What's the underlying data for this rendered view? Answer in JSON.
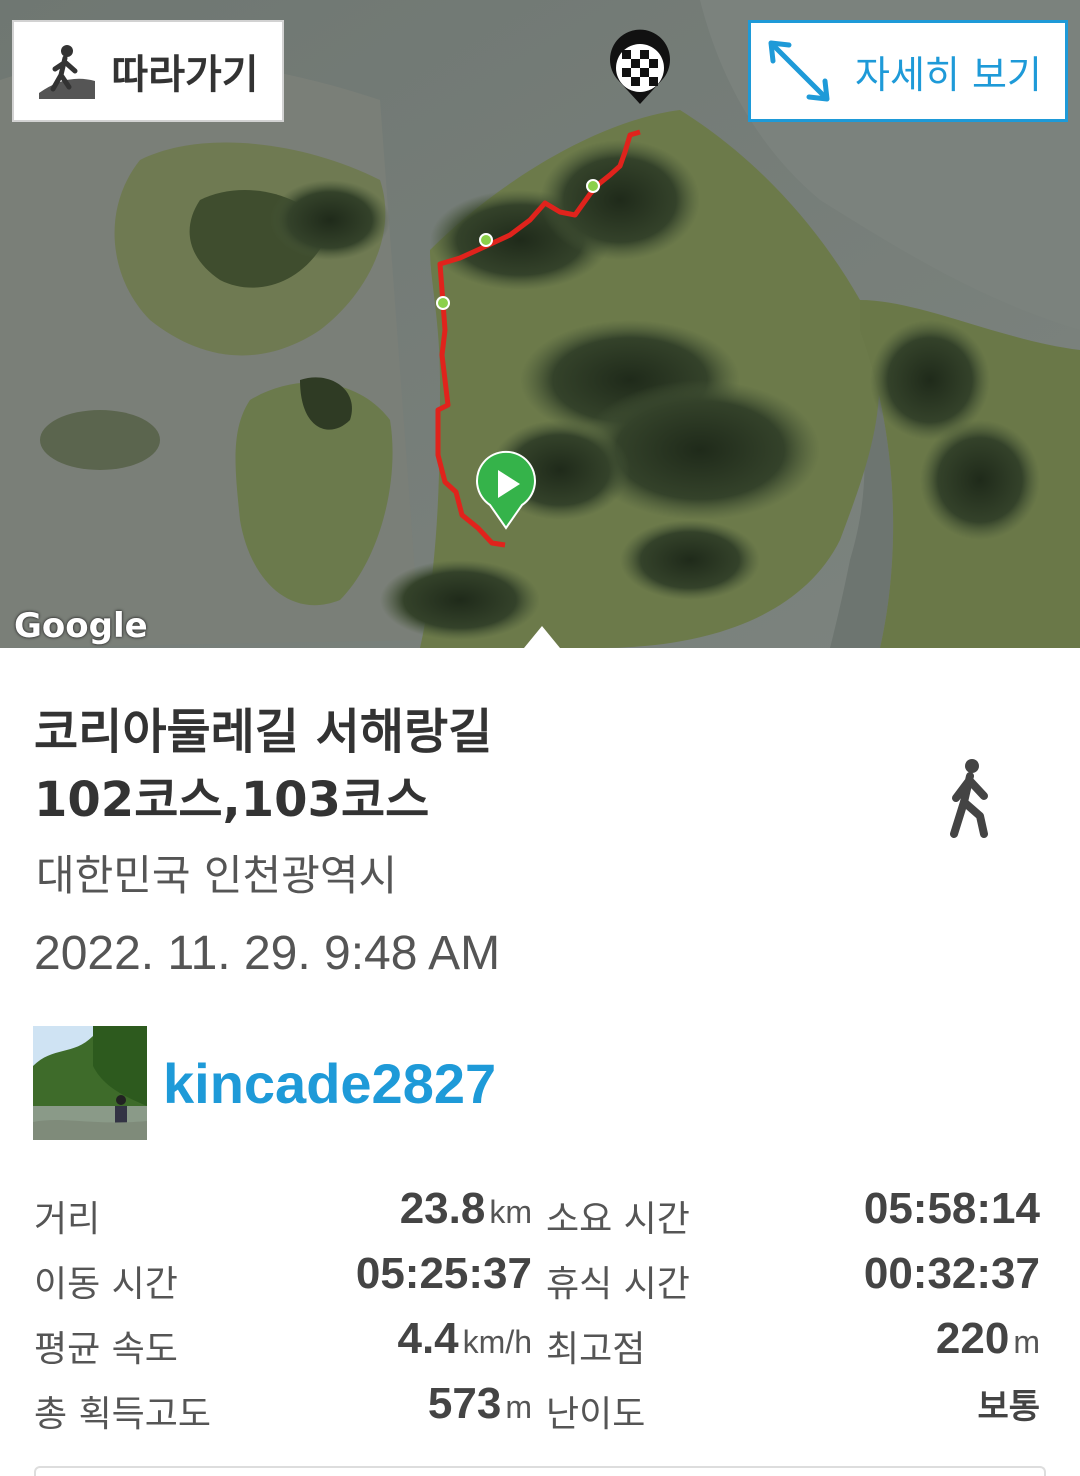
{
  "map": {
    "follow_button": {
      "label": "따라가기",
      "icon": "hiker-icon"
    },
    "detail_button": {
      "label": "자세히 보기",
      "icon": "expand-arrows-icon"
    },
    "attribution": "Google",
    "markers": {
      "start": "start-play-marker",
      "finish": "finish-flag-marker"
    },
    "route_color": "#e0231c"
  },
  "track": {
    "title_line1": "코리아둘레길 서해랑길",
    "title_line2": "102코스,103코스",
    "activity_icon": "walking-person-icon",
    "region": "대한민국 인천광역시",
    "datetime": "2022. 11. 29. 9:48 AM"
  },
  "user": {
    "name": "kincade2827",
    "avatar": "hiker-photo-avatar"
  },
  "stats": {
    "distance": {
      "label": "거리",
      "value": "23.8",
      "unit": "km"
    },
    "total_time": {
      "label": "소요 시간",
      "value": "05:58:14"
    },
    "moving_time": {
      "label": "이동 시간",
      "value": "05:25:37"
    },
    "rest_time": {
      "label": "휴식 시간",
      "value": "00:32:37"
    },
    "avg_speed": {
      "label": "평균 속도",
      "value": "4.4",
      "unit": "km/h"
    },
    "max_altitude": {
      "label": "최고점",
      "value": "220",
      "unit": "m"
    },
    "total_ascent": {
      "label": "총 획득고도",
      "value": "573",
      "unit": "m"
    },
    "difficulty": {
      "label": "난이도",
      "value": "보통"
    }
  },
  "colors": {
    "accent": "#1e9ad8",
    "text": "#333333"
  }
}
